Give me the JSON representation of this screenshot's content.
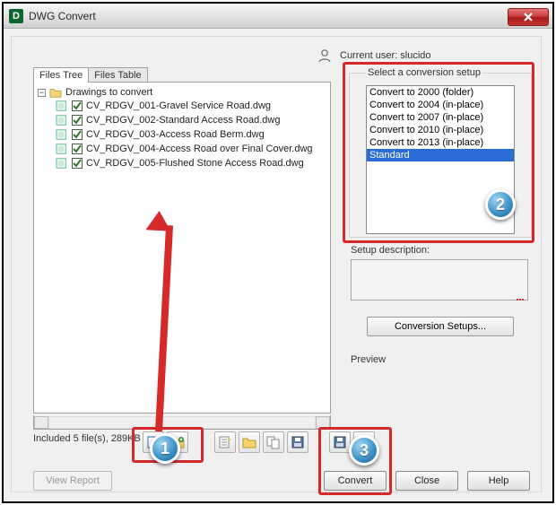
{
  "window": {
    "title": "DWG Convert"
  },
  "user": {
    "prefix": "Current user:",
    "name": "slucido"
  },
  "tabs": {
    "tree": "Files Tree",
    "table": "Files Table"
  },
  "tree": {
    "root": "Drawings to convert",
    "files": [
      "CV_RDGV_001-Gravel Service Road.dwg",
      "CV_RDGV_002-Standard Access Road.dwg",
      "CV_RDGV_003-Access Road Berm.dwg",
      "CV_RDGV_004-Access Road over Final Cover.dwg",
      "CV_RDGV_005-Flushed Stone Access Road.dwg"
    ]
  },
  "status": {
    "text": "Included 5 file(s), 289KB"
  },
  "view_report": "View Report",
  "setup": {
    "legend": "Select a conversion setup",
    "items": [
      "Convert to 2000 (folder)",
      "Convert to 2004 (in-place)",
      "Convert to 2007 (in-place)",
      "Convert to 2010 (in-place)",
      "Convert to 2013 (in-place)",
      "Standard"
    ],
    "selected_index": 5
  },
  "desc_label": "Setup description:",
  "conv_setups_btn": "Conversion Setups...",
  "preview_label": "Preview",
  "buttons": {
    "convert": "Convert",
    "close": "Close",
    "help": "Help"
  },
  "annotations": {
    "b1": "1",
    "b2": "2",
    "b3": "3"
  }
}
